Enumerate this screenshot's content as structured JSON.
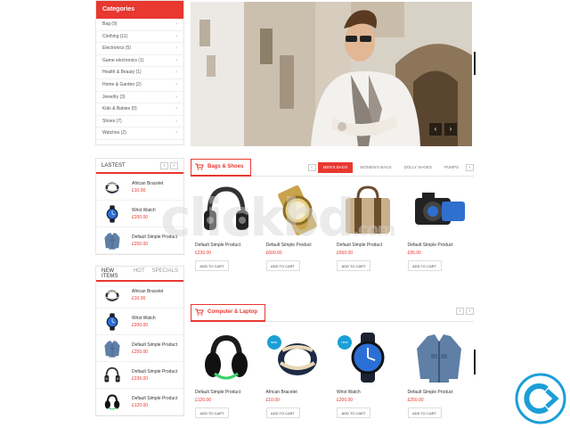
{
  "categories": {
    "title": "Categories",
    "items": [
      {
        "label": "Bag (9)"
      },
      {
        "label": "Clothing (11)"
      },
      {
        "label": "Electronics (5)"
      },
      {
        "label": "Game electronics (1)"
      },
      {
        "label": "Health & Beauty (1)"
      },
      {
        "label": "Home & Garden (2)"
      },
      {
        "label": "Jewellry (3)"
      },
      {
        "label": "Kids & Babies (0)"
      },
      {
        "label": "Shoes (7)"
      },
      {
        "label": "Watches (2)"
      }
    ]
  },
  "latest": {
    "title": "LASTEST",
    "items": [
      {
        "name": "African Bracelet",
        "price": "£10.00",
        "icon": "bracelet"
      },
      {
        "name": "Wrist Watch",
        "price": "£200.00",
        "icon": "watch"
      },
      {
        "name": "Default Simple Product",
        "price": "£250.00",
        "icon": "jacket"
      }
    ]
  },
  "new_items": {
    "tabs": [
      "NEW ITEMS",
      "HOT",
      "SPECIALS"
    ],
    "items": [
      {
        "name": "African Bracelet",
        "price": "£10.00",
        "icon": "bracelet"
      },
      {
        "name": "Wrist Watch",
        "price": "£200.00",
        "icon": "watch"
      },
      {
        "name": "Default Simple Product",
        "price": "£250.00",
        "icon": "jacket"
      },
      {
        "name": "Default Simple Product",
        "price": "£236.00",
        "icon": "headphones"
      },
      {
        "name": "Default Simple Product",
        "price": "£120.00",
        "icon": "headset"
      }
    ]
  },
  "hero": {
    "prev": "‹",
    "next": "›"
  },
  "bags": {
    "title": "Bags & Shoes",
    "tabs": [
      "MEN'S BAGS",
      "WOMEN'S BAGS",
      "DOLLY SHOES",
      "PUMPS"
    ],
    "products": [
      {
        "name": "Default Simple Product",
        "price": "£236.00",
        "cta": "ADD TO CART",
        "icon": "headphones"
      },
      {
        "name": "Default Simple Product",
        "price": "£600.00",
        "cta": "ADD TO CART",
        "icon": "gold-watch"
      },
      {
        "name": "Default Simple Product",
        "price": "£650.00",
        "cta": "ADD TO CART",
        "icon": "bag"
      },
      {
        "name": "Default Simple Product",
        "price": "£95.00",
        "cta": "ADD TO CART",
        "icon": "camera"
      }
    ]
  },
  "computer": {
    "title": "Computer & Laptop",
    "products": [
      {
        "name": "Default Simple Product",
        "price": "£120.00",
        "cta": "ADD TO CART",
        "new": false,
        "icon": "headset"
      },
      {
        "name": "African Bracelet",
        "price": "£10.00",
        "cta": "ADD TO CART",
        "new": true,
        "badge": "new",
        "icon": "bracelet"
      },
      {
        "name": "Wrist Watch",
        "price": "£200.00",
        "cta": "ADD TO CART",
        "new": true,
        "badge": "new",
        "icon": "watch"
      },
      {
        "name": "Default Simple Product",
        "price": "£250.00",
        "cta": "ADD TO CART",
        "new": false,
        "icon": "jacket"
      }
    ]
  },
  "watermark": {
    "text": "clickbd",
    "suffix": ".com"
  },
  "colors": {
    "accent": "#e8382f",
    "badge": "#1a9fd6"
  }
}
